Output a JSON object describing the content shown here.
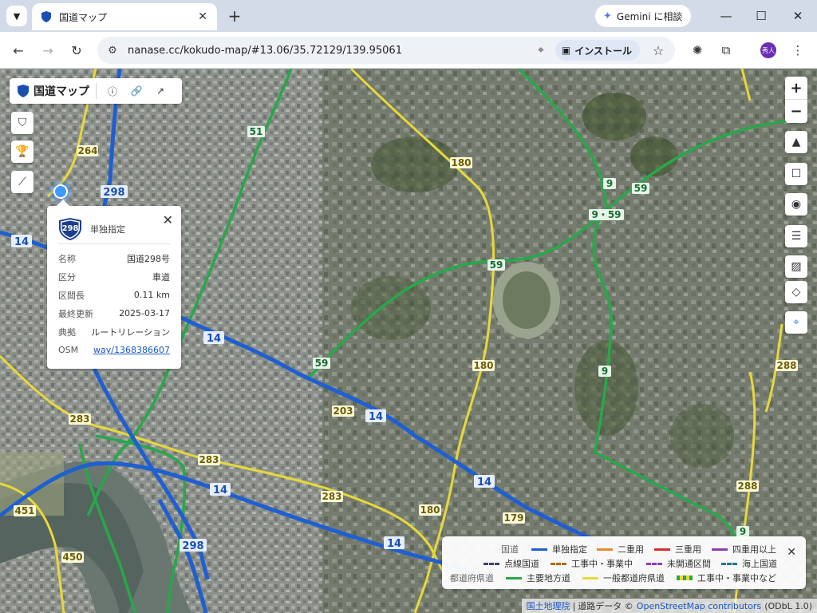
{
  "browser": {
    "tab_title": "国道マップ",
    "gemini_label": "Gemini に相談",
    "url": "nanase.cc/kokudo-map/#13.06/35.72129/139.95061",
    "install_label": "インストール",
    "profile_label": "秀人"
  },
  "app": {
    "brand_name": "国道マップ"
  },
  "popup": {
    "shield_number": "298",
    "type": "単独指定",
    "rows": [
      {
        "key": "名称",
        "value": "国道298号"
      },
      {
        "key": "区分",
        "value": "車道"
      },
      {
        "key": "区間長",
        "value": "0.11 km"
      },
      {
        "key": "最終更新",
        "value": "2025-03-17"
      },
      {
        "key": "典拠",
        "value": "ルートリレーション"
      }
    ],
    "osm_key": "OSM",
    "osm_link": "way/1368386607"
  },
  "legend": {
    "national_label": "国道",
    "prefectural_label": "都道府県道",
    "items": {
      "single": "単独指定",
      "double": "二重用",
      "triple": "三重用",
      "quad": "四重用以上",
      "point": "点線国道",
      "construction": "工事中・事業中",
      "unopened": "未開通区間",
      "sea": "海上国道",
      "main_local": "主要地方道",
      "general_pref": "一般都道府県道",
      "pref_construction": "工事中・事業中など"
    },
    "colors": {
      "single": "#1f5fd1",
      "double": "#e98a2b",
      "triple": "#d62f2f",
      "quad": "#8a3fb5",
      "point": "#3a4466",
      "construction": "#a96a1a",
      "unopened": "#8a3fb5",
      "sea": "#177a8a",
      "main_local": "#27a84a",
      "general_pref": "#e8d83a"
    }
  },
  "map_labels": {
    "r14": "14",
    "r298": "298",
    "r264": "264",
    "r51": "51",
    "r180": "180",
    "r9": "9",
    "r59": "59",
    "r9_59": "9・59",
    "r283": "283",
    "r203": "203",
    "r451": "451",
    "r450": "450",
    "r179": "179",
    "r288": "288"
  },
  "attribution": {
    "gsi": "国土地理院",
    "sep1": "|",
    "data": "道路データ ©",
    "osm": "OpenStreetMap contributors",
    "license": "(ODbL 1.0)"
  }
}
